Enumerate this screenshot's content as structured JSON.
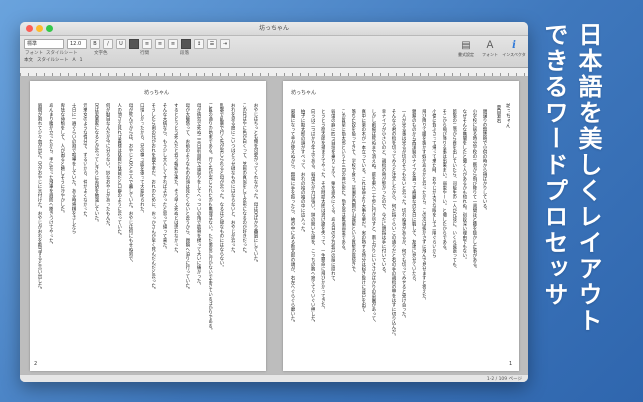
{
  "window": {
    "title": "坊っちゃん"
  },
  "toolbar": {
    "font_style": "標準",
    "font_size": "12.0",
    "labels": [
      "フォント",
      "スタイルシート",
      "文字色",
      "行間",
      "段落"
    ],
    "row2_items": [
      "本文",
      "スタイルシート",
      "A",
      "1"
    ],
    "right_items": [
      {
        "icon": "inspector-icon",
        "glyph": "▤",
        "label": "書式設定"
      },
      {
        "icon": "font-icon",
        "glyph": "Ａ",
        "label": "フォント"
      },
      {
        "icon": "info-icon",
        "glyph": "i",
        "label": "インスペクタ"
      }
    ]
  },
  "document": {
    "running_head_left": "坊っちゃん",
    "running_head_right": "坊っちゃん",
    "title": "坊っちゃん",
    "author": "夏目漱石",
    "page_left_number": "2",
    "page_right_number": "1",
    "left_columns": [
      "おやじはちっとも俺を可愛がってくれなかった。母は兄ばかり贔屓にしていた。",
      "この兄はやに色が白くって、芝居の真似をして女形になるのが好きだった。",
      "おれを見る度にこいつはどうせ碌なものにはならないと、おやじが云った。",
      "乱暴で乱暴で行く先が案じられると母が云った。なるほど碌なものにはならない。",
      "ご覧の通りの始末である。行く先が案じられたのも無理はない。ただ懲役に行かないで生きているばかりである。",
      "母が病気で死ぬ二三日前台所で宙返りをしてへっついの角で肋骨を撲って大いに痛かった。",
      "母が大層怒って、お前のようなものの顔は見たくないと云うから、親類へ泊りに行っていた。",
      "するととうとう死んだと云う報知が来た。そう早く死ぬとは思わなかった。",
      "そんな大病なら、もう少し大人しくすればよかったと思って帰って来た。",
      "そうしたら例の兄がおれを親不孝だ、おれのために、おっかさんが早く死んだんだと云った。",
      "口惜しかったから、兄の横っ面を張って大変叱られた。",
      "母が死んでからは、おやじと兄と三人で暮していた。おやじは何にもせぬ男で、",
      "人の顔さえ見れば貴様は駄目だ駄目だと口癖のように云っていた。",
      "何が駄目なんだか今に分らない。妙なおやじがあったもんだ。",
      "兄は実業家になるとか云ってしきりに英語を勉強していた。",
      "元来女のような性分で、ずるいから、仲がよくなかった。",
      "十日に一遍ぐらいの割で喧嘩をしていた。ある時将棋をさしたら",
      "卑怯な待駒をして、人が困ると嬉しそうに冷やかした。",
      "あんまり腹が立ったから、手に在った飛車を眉間へ擲きつけてやった。",
      "眉間が割れて少々血が出た。兄がおやじに言付けた。おやじがおれを勘当すると言い出した。"
    ],
    "right_columns": [
      "親譲りの無鉄砲で小供の時から損ばかりしている。",
      "小学校に居る時分学校の二階から飛び降りて一週間ほど腰を抜かした事がある。",
      "なぜそんな無闇をしたと聞く人があるかも知れぬ。別段深い理由でもない。",
      "新築の二階から首を出していたら、同級生の一人が冗談に、いくら威張っても、",
      "そこから飛び降りる事は出来まい。弱虫やーい。と囃したからである。",
      "小使に負ぶさって帰って来た時、おやじが大きな眼をして二階ぐらいから",
      "飛び降りて腰を抜かす奴があるかと云ったから、この次は抜かさずに飛んで見せますと答えた。",
      "親類のものから西洋製のナイフを貰って奇麗な刃を日に翳して、友達に見せていたら、",
      "一人が光る事は光るが切れそうもないと云った。切れぬ事があるか、何でも切ってみせると受け合った。",
      "そんなら君の指を切ってみろと注文したから、何だ指ぐらいこの通りだと右の手の親指の甲をはすに切り込んだ。",
      "幸ナイフが小さいのと、親指の骨が堅かったので、今だに親指は手に付いている。",
      "しかし創痕は死ぬまで消えぬ。庭を東へ二十歩に行き尽すと、南上がりにいささかばかりの菜園があって、",
      "真中に栗の木が一本立っている。これは命より大事な栗だ。実の熟する時分は起き抜けに背戸を出て",
      "落ちた奴を拾ってきて、学校で食う。菜園の西側が山城屋という質屋の庭続きで、",
      "この質屋に勘太郎という十三四の倅が居た。勘太郎は無論弱虫である。",
      "弱虫の癖に四つ目垣を乗りこえて、栗を盗みにくる。ある日の夕方折戸の蔭に隠れて、",
      "とうとう勘太郎を捕まえてやった。その時勘太郎は逃げ路を失って、一生懸命に飛びかかってきた。",
      "向うは二つばかり年上である。弱虫だが力は強い。鉢の開いた頭を、こっちの胸へ宛ててぐいぐい押した。",
      "拍子に勘太郎の頭がすべって、おれの袷の袖の中に這入った。",
      "邪魔になって手が使えぬから、無暗に手を振ったら、袖の中にある勘太郎の頭が、右左へぐらぐら靡いた。"
    ]
  },
  "status": {
    "page_info": "1-2 / 109 ページ"
  },
  "headline": {
    "lines": [
      "日本語を美しくレイアウト",
      "できるワードプロセッサ"
    ]
  }
}
